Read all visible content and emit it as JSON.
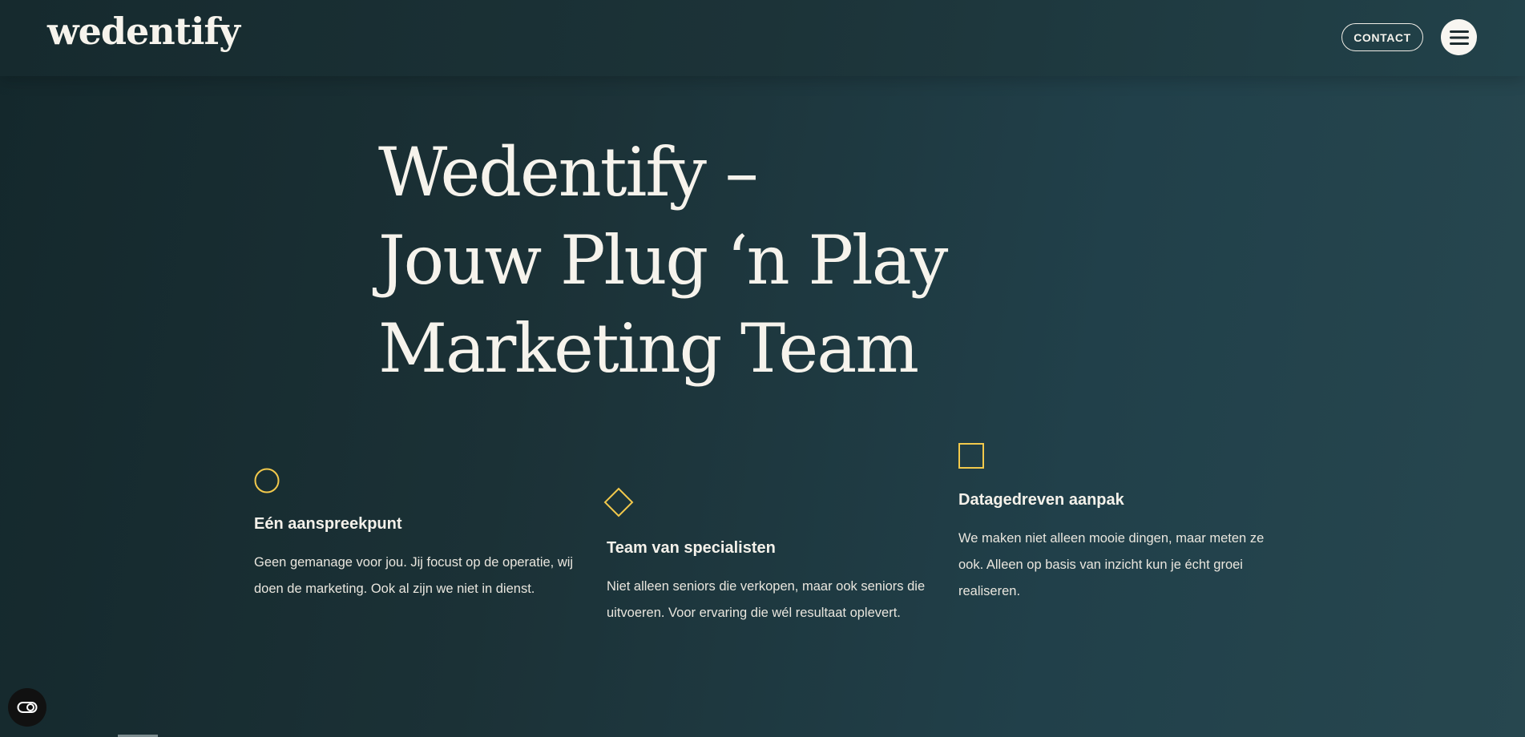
{
  "header": {
    "logo_text": "wedentify",
    "contact_label": "CONTACT",
    "menu_icon": "hamburger-menu-icon"
  },
  "hero": {
    "title_lines": [
      "Wedentify –",
      "Jouw Plug ‘n Play",
      "Marketing Team"
    ]
  },
  "features": [
    {
      "icon": "circle-outline-icon",
      "title": "Eén aanspreekpunt",
      "text": "Geen gemanage voor jou. Jij focust op de operatie, wij doen de marketing. Ook al zijn we niet in dienst."
    },
    {
      "icon": "diamond-outline-icon",
      "title": "Team van specialisten",
      "text": "Niet alleen seniors die verkopen, maar ook seniors die uitvoeren. Voor ervaring die wél resultaat oplevert."
    },
    {
      "icon": "square-outline-icon",
      "title": "Datagedreven aanpak",
      "text": "We maken niet alleen mooie dingen, maar meten ze ook. Alleen op basis van inzicht kun je écht groei realiseren."
    }
  ],
  "accessibility": {
    "icon": "accessibility-toggle-icon"
  },
  "colors": {
    "accent": "#f2c94c",
    "background": "#1b3136",
    "text": "#f4f1ea"
  }
}
